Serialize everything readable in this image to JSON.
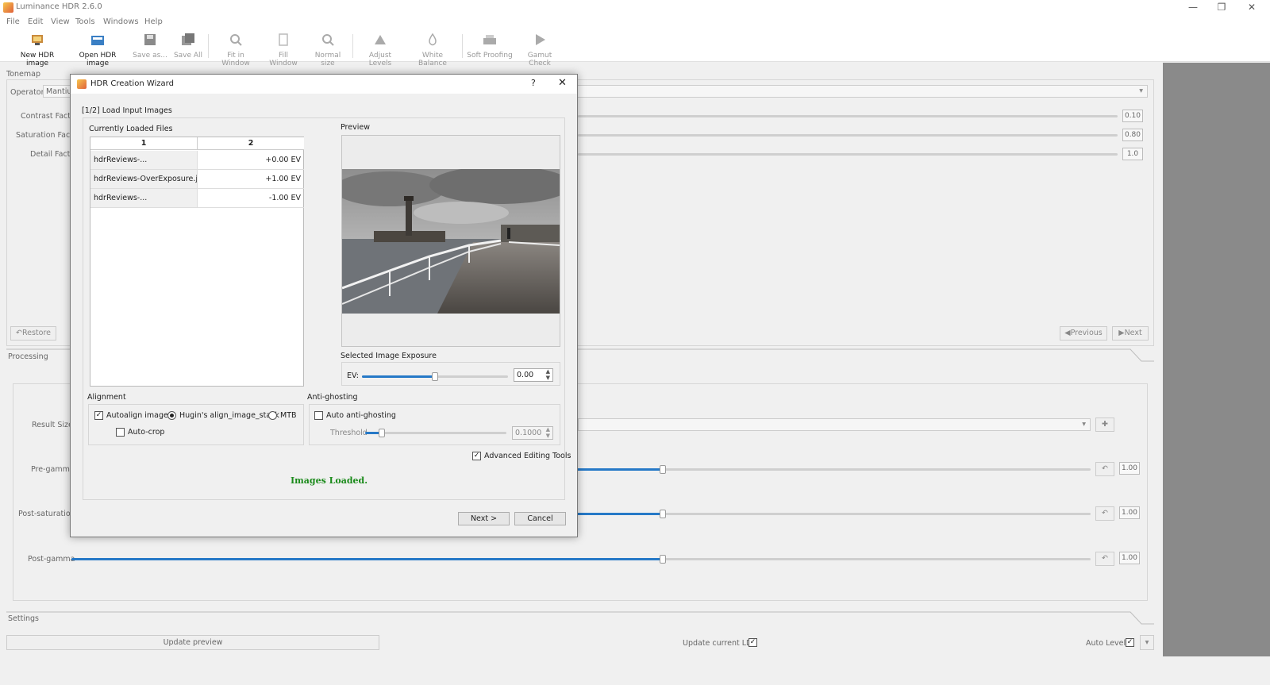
{
  "app": {
    "title": "Luminance HDR 2.6.0",
    "window_controls": [
      "—",
      "❐",
      "✕"
    ]
  },
  "menu": [
    "File",
    "Edit",
    "View",
    "Tools",
    "Windows",
    "Help"
  ],
  "toolbar": [
    {
      "label": "New HDR image",
      "icon": "new-hdr-icon",
      "enabled": true
    },
    {
      "label": "Open HDR image",
      "icon": "open-hdr-icon",
      "enabled": true
    },
    {
      "label": "Save as...",
      "icon": "save-icon",
      "enabled": false
    },
    {
      "label": "Save All",
      "icon": "save-all-icon",
      "enabled": false
    },
    {
      "label": "Fit in Window",
      "icon": "zoom-fit-icon",
      "enabled": false
    },
    {
      "label": "Fill Window",
      "icon": "fill-window-icon",
      "enabled": false
    },
    {
      "label": "Normal size",
      "icon": "zoom-normal-icon",
      "enabled": false
    },
    {
      "label": "Adjust Levels",
      "icon": "levels-icon",
      "enabled": false
    },
    {
      "label": "White Balance",
      "icon": "white-balance-icon",
      "enabled": false
    },
    {
      "label": "Soft Proofing",
      "icon": "soft-proofing-icon",
      "enabled": false
    },
    {
      "label": "Gamut Check",
      "icon": "gamut-check-icon",
      "enabled": false
    }
  ],
  "tonemap": {
    "section": "Tonemap",
    "operator_label": "Operator",
    "operator_value": "Mantiuk",
    "contrast_label": "Contrast Factor",
    "saturation_label": "Saturation Factor",
    "detail_label": "Detail Factor",
    "contrast_value": "0.10",
    "saturation_value": "0.80",
    "detail_value": "1.0",
    "restore": "Restore",
    "previous": "Previous",
    "next": "Next"
  },
  "processing": {
    "section": "Processing",
    "result_size": "Result Size",
    "pre_gamma": "Pre-gamma",
    "post_saturation": "Post-saturation",
    "post_gamma": "Post-gamma",
    "pre_gamma_value": "1.00",
    "post_saturation_value": "1.00",
    "post_gamma_value": "1.00",
    "slider_fraction": 0.58
  },
  "settings": {
    "section": "Settings",
    "update_preview": "Update preview",
    "update_current_ldr": "Update current LDR",
    "auto_levels": "Auto Levels"
  },
  "dialog": {
    "title": "HDR Creation Wizard",
    "help": "?",
    "close": "✕",
    "step": "[1/2] Load Input Images",
    "files_label": "Currently Loaded Files",
    "columns": [
      "1",
      "2"
    ],
    "rows": [
      {
        "name": "hdrReviews-...",
        "ev": "+0.00 EV"
      },
      {
        "name": "hdrReviews-OverExposure.jpg",
        "ev": "+1.00 EV"
      },
      {
        "name": "hdrReviews-...",
        "ev": "-1.00 EV"
      }
    ],
    "preview_label": "Preview",
    "exposure_label": "Selected Image Exposure",
    "ev_label": "EV:",
    "ev_value": "0.00",
    "ev_fraction": 0.5,
    "alignment_label": "Alignment",
    "autoalign": "Autoalign images",
    "hugin": "Hugin's align_image_stack",
    "mtb": "MTB",
    "autocrop": "Auto-crop",
    "antighost_label": "Anti-ghosting",
    "auto_antighost": "Auto anti-ghosting",
    "threshold_label": "Threshold",
    "threshold_value": "0.1000",
    "threshold_fraction": 0.12,
    "advanced_tools": "Advanced Editing Tools",
    "status": "Images Loaded.",
    "status_color": "#1a8a1a",
    "next_button": "Next >",
    "cancel_button": "Cancel"
  },
  "colors": {
    "accent": "#2679c7",
    "right_panel": "#8a8a8a"
  }
}
